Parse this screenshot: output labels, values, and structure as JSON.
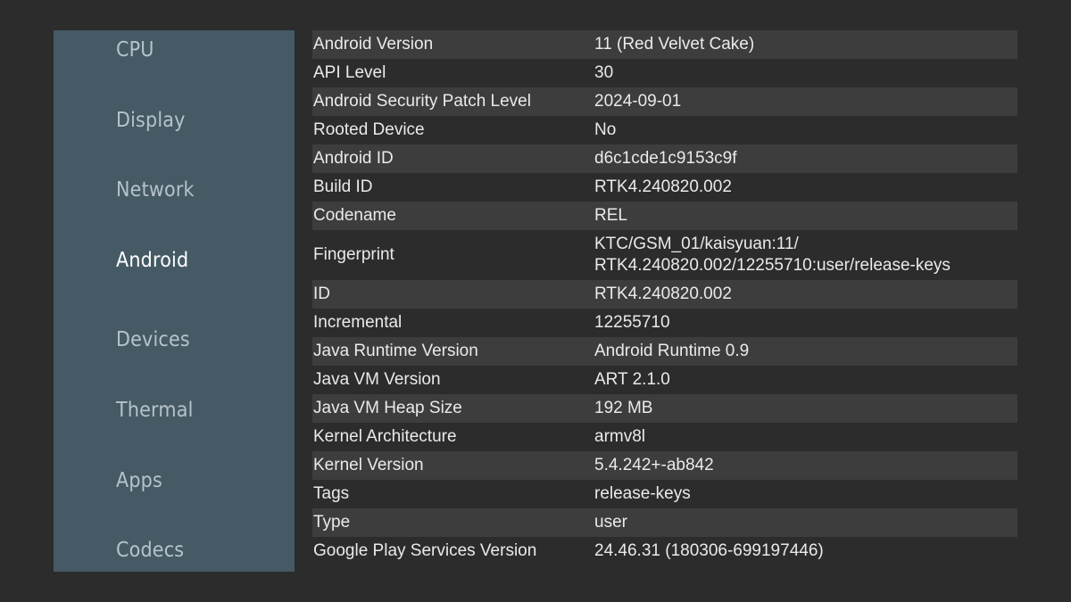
{
  "sidebar": {
    "items": [
      {
        "label": "CPU",
        "active": false
      },
      {
        "label": "Display",
        "active": false
      },
      {
        "label": "Network",
        "active": false
      },
      {
        "label": "Android",
        "active": true
      },
      {
        "label": "Devices",
        "active": false
      },
      {
        "label": "Thermal",
        "active": false
      },
      {
        "label": "Apps",
        "active": false
      },
      {
        "label": "Codecs",
        "active": false
      }
    ]
  },
  "info": {
    "rows": [
      {
        "key": "Android Version",
        "value": "11 (Red Velvet Cake)"
      },
      {
        "key": "API Level",
        "value": "30"
      },
      {
        "key": "Android Security Patch Level",
        "value": "2024-09-01"
      },
      {
        "key": "Rooted Device",
        "value": "No"
      },
      {
        "key": "Android ID",
        "value": "d6c1cde1c9153c9f"
      },
      {
        "key": "Build ID",
        "value": "RTK4.240820.002"
      },
      {
        "key": "Codename",
        "value": "REL"
      },
      {
        "key": "Fingerprint",
        "value": "KTC/GSM_01/kaisyuan:11/\nRTK4.240820.002/12255710:user/release-keys"
      },
      {
        "key": "ID",
        "value": "RTK4.240820.002"
      },
      {
        "key": "Incremental",
        "value": "12255710"
      },
      {
        "key": "Java Runtime Version",
        "value": "Android Runtime 0.9"
      },
      {
        "key": "Java VM Version",
        "value": "ART 2.1.0"
      },
      {
        "key": "Java VM Heap Size",
        "value": "192 MB"
      },
      {
        "key": "Kernel Architecture",
        "value": "armv8l"
      },
      {
        "key": "Kernel Version",
        "value": "5.4.242+-ab842"
      },
      {
        "key": "Tags",
        "value": "release-keys"
      },
      {
        "key": "Type",
        "value": "user"
      },
      {
        "key": "Google Play Services Version",
        "value": "24.46.31 (180306-699197446)"
      }
    ]
  }
}
